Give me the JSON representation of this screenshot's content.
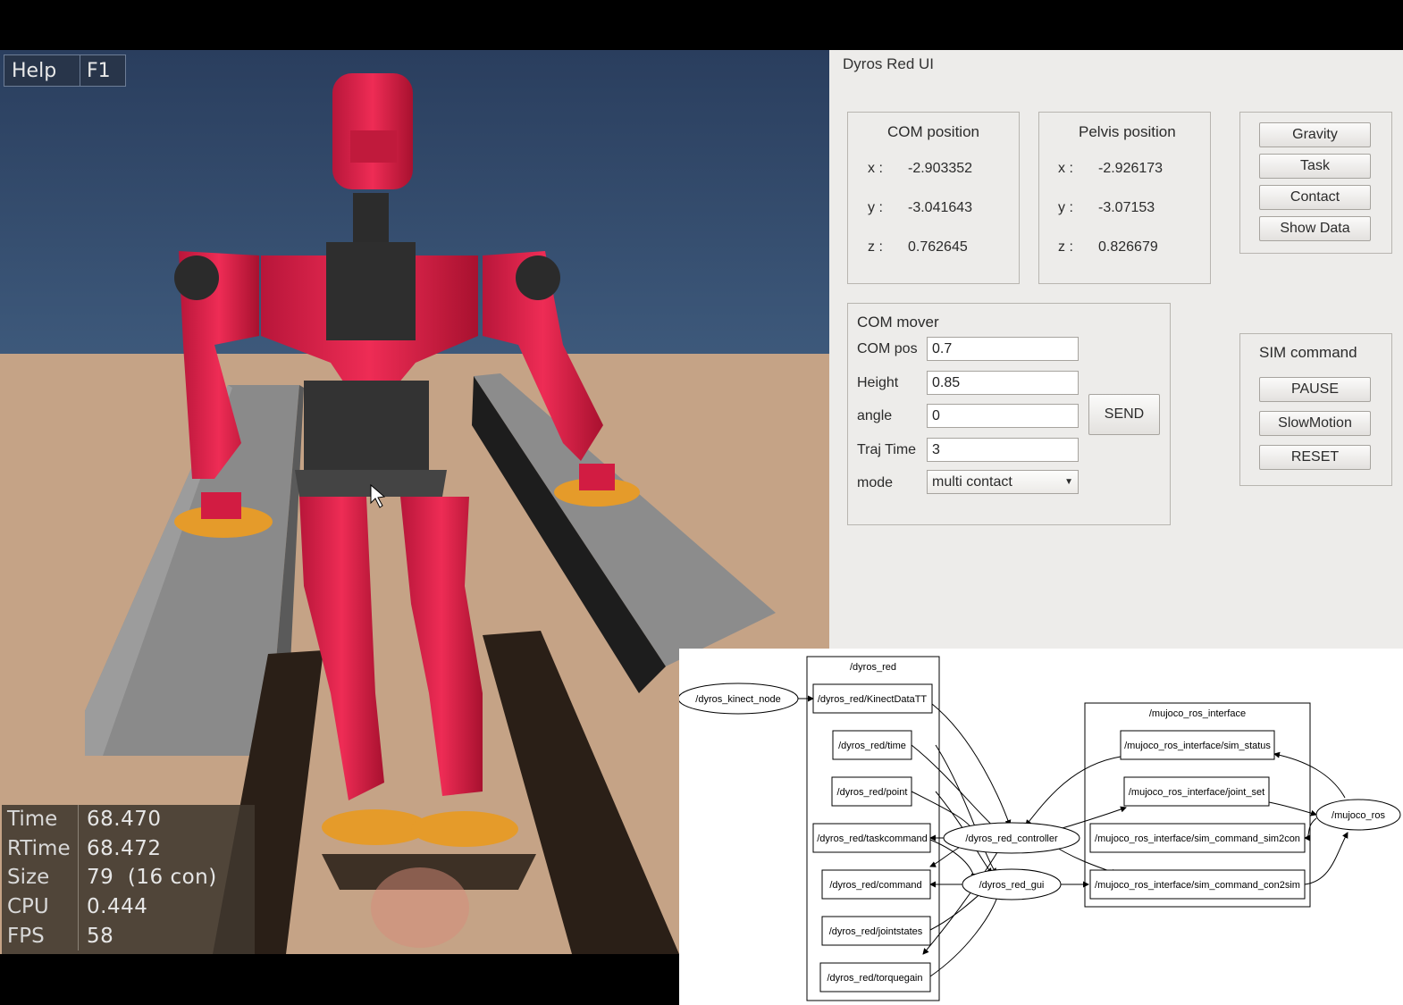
{
  "simulator": {
    "help": {
      "key": "Help",
      "value": "F1"
    },
    "stats": [
      {
        "key": "Time",
        "value": "68.470"
      },
      {
        "key": "RTime",
        "value": "68.472"
      },
      {
        "key": "Size",
        "value": "79  (16 con)"
      },
      {
        "key": "CPU",
        "value": "0.444"
      },
      {
        "key": "FPS",
        "value": "58"
      }
    ]
  },
  "gui": {
    "window_title": "Dyros Red UI",
    "com_position": {
      "title": "COM position",
      "x_label": "x :",
      "x": "-2.903352",
      "y_label": "y :",
      "y": "-3.041643",
      "z_label": "z :",
      "z": "0.762645"
    },
    "pelvis_position": {
      "title": "Pelvis position",
      "x_label": "x :",
      "x": "-2.926173",
      "y_label": "y :",
      "y": "-3.07153",
      "z_label": "z :",
      "z": "0.826679"
    },
    "buttons": [
      "Gravity",
      "Task",
      "Contact",
      "Show Data"
    ],
    "com_mover": {
      "title": "COM mover",
      "com_pos_label": "COM pos",
      "com_pos": "0.7",
      "height_label": "Height",
      "height": "0.85",
      "angle_label": "angle",
      "angle": "0",
      "traj_time_label": "Traj Time",
      "traj_time": "3",
      "mode_label": "mode",
      "mode": "multi contact",
      "send": "SEND"
    },
    "sim_command": {
      "title": "SIM command",
      "pause": "PAUSE",
      "slowmotion": "SlowMotion",
      "reset": "RESET"
    }
  },
  "graph": {
    "clusters": {
      "dyros_red": "/dyros_red",
      "mujoco": "/mujoco_ros_interface"
    },
    "nodes": {
      "kinect_node": "/dyros_kinect_node",
      "controller": "/dyros_red_controller",
      "gui": "/dyros_red_gui",
      "mujoco_ros": "/mujoco_ros"
    },
    "topics": {
      "kinect": "/dyros_red/KinectDataTT",
      "time": "/dyros_red/time",
      "point": "/dyros_red/point",
      "taskcommand": "/dyros_red/taskcommand",
      "command": "/dyros_red/command",
      "jointstates": "/dyros_red/jointstates",
      "torquegain": "/dyros_red/torquegain",
      "sim_status": "/mujoco_ros_interface/sim_status",
      "joint_set": "/mujoco_ros_interface/joint_set",
      "sim2con": "/mujoco_ros_interface/sim_command_sim2con",
      "con2sim": "/mujoco_ros_interface/sim_command_con2sim"
    }
  }
}
